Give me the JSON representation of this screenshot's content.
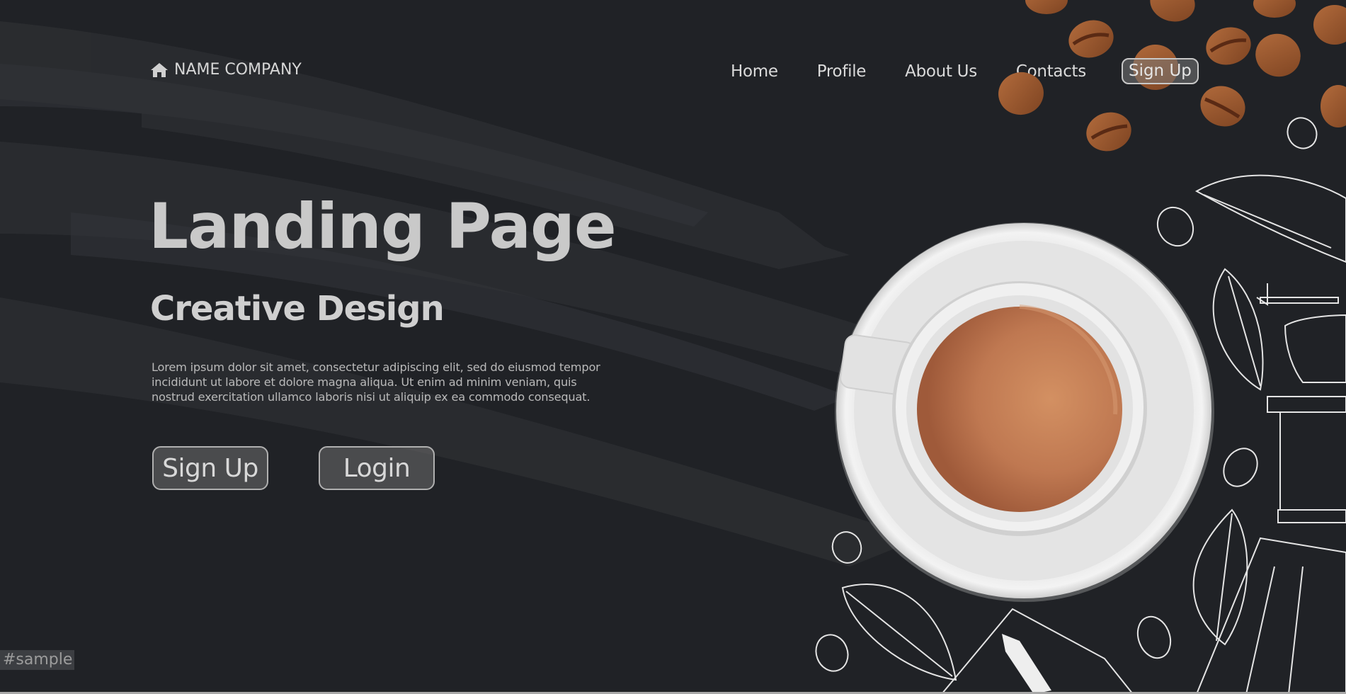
{
  "header": {
    "brand_icon": "home-icon",
    "brand_name": "NAME COMPANY",
    "nav": [
      {
        "label": "Home"
      },
      {
        "label": "Profile"
      },
      {
        "label": "About Us"
      },
      {
        "label": "Contacts"
      }
    ],
    "signup_label": "Sign Up"
  },
  "hero": {
    "title": "Landing Page",
    "subtitle": "Creative Design",
    "body": "Lorem ipsum dolor sit amet, consectetur adipiscing elit, sed do eiusmod tempor incididunt ut labore et dolore magna aliqua. Ut enim ad minim veniam, quis nostrud exercitation ullamco laboris nisi ut aliquip ex ea commodo consequat.",
    "signup_button": "Sign Up",
    "login_button": "Login"
  },
  "illustration": {
    "items": [
      "coffee-cup-icon",
      "coffee-bean-icon",
      "coffee-leaf-icon",
      "coffee-grinder-icon",
      "paper-cup-icon"
    ],
    "colors": {
      "background": "#202226",
      "coffee": "#c07a50",
      "bean": "#9a5a32",
      "cup": "#eeeeee",
      "sketch": "#e8e8e8"
    }
  },
  "watermark": "#sample"
}
